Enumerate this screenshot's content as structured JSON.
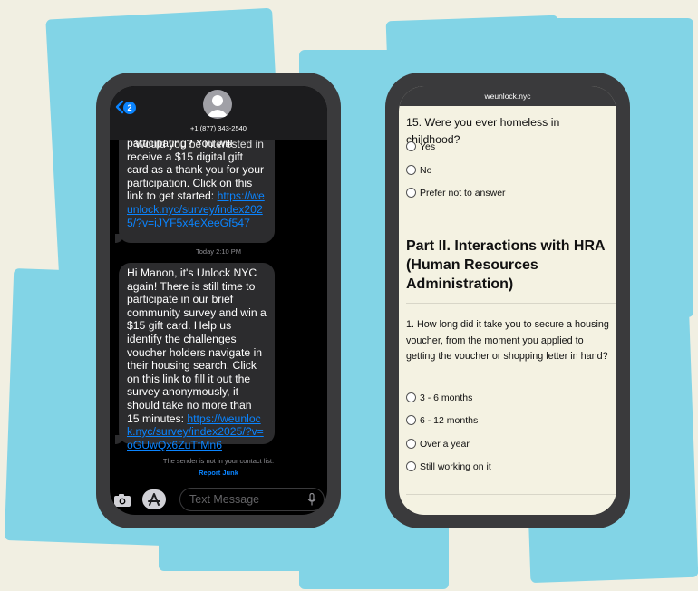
{
  "colors": {
    "background": "#f1efe2",
    "accent_shapes": "#82d4e6",
    "phone_frame": "#3a3a3c",
    "link": "#0a84ff",
    "bubble": "#2c2c2e",
    "survey_bg": "#f4f2e2"
  },
  "messages": {
    "back_badge": "2",
    "contact_number": "+1 (877) 343-2540",
    "bubble1": {
      "partial_top": "Would you be interested in",
      "text": "participating? You will receive a $15 digital gift card as a thank you for your participation. Click on this link to get started: ",
      "link": "https://weunlock.nyc/survey/index2025/?v=iJYF5x4eXeeGf547"
    },
    "timestamp": "Today 2:10 PM",
    "bubble2": {
      "text": "Hi Manon, it's Unlock NYC again! There is still time to participate in our brief community survey and win a $15 gift card. Help us identify the challenges voucher holders navigate in their housing search. Click on this link to fill it out the survey anonymously, it should take no more than 15 minutes: ",
      "link": "https://weunlock.nyc/survey/index2025/?v=oGUwQx6ZuTfMn6"
    },
    "sender_note": "The sender is not in your contact list.",
    "report_junk": "Report Junk",
    "input_placeholder": "Text Message",
    "icons": [
      "chevron-left-icon",
      "person-icon",
      "camera-icon",
      "app-store-icon",
      "microphone-icon"
    ]
  },
  "survey": {
    "url": "weunlock.nyc",
    "q15": {
      "title": "15. Were you ever homeless in childhood?",
      "options": [
        "Yes",
        "No",
        "Prefer not to answer"
      ]
    },
    "part2_title": "Part II. Interactions with HRA (Human Resources Administration)",
    "q1": {
      "title": "1. How long did it take you to secure a housing voucher, from the moment you applied to getting the voucher or shopping letter in hand?",
      "options": [
        "3 - 6 months",
        "6 - 12 months",
        "Over a year",
        "Still working on it"
      ]
    }
  }
}
